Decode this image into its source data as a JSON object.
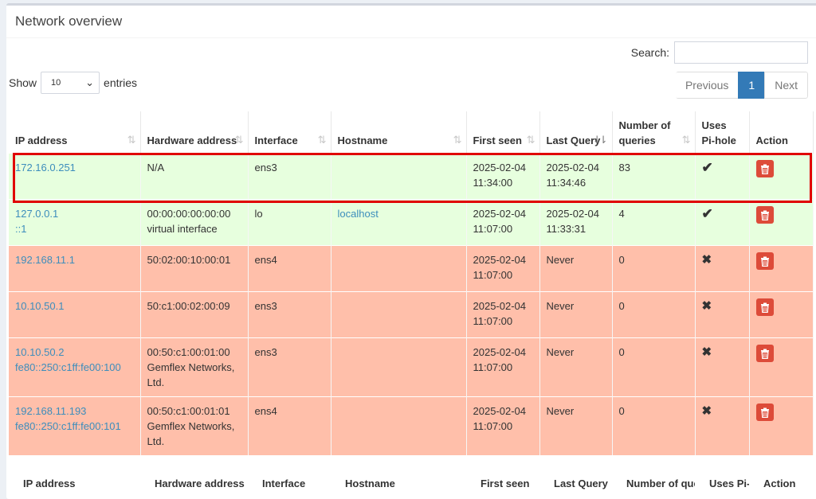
{
  "title": "Network overview",
  "search": {
    "label": "Search:",
    "value": ""
  },
  "length": {
    "show": "Show",
    "value": "10",
    "entries": "entries"
  },
  "pager": {
    "previous": "Previous",
    "current": "1",
    "next": "Next"
  },
  "columns": [
    {
      "label": "IP address",
      "sort": "both"
    },
    {
      "label": "Hardware address",
      "sort": "both"
    },
    {
      "label": "Interface",
      "sort": "both"
    },
    {
      "label": "Hostname",
      "sort": "both"
    },
    {
      "label": "First seen",
      "sort": "both"
    },
    {
      "label": "Last Query",
      "sort": "desc"
    },
    {
      "label": "Number of queries",
      "sort": "both"
    },
    {
      "label": "Uses Pi-hole",
      "sort": "none"
    },
    {
      "label": "Action",
      "sort": "none"
    }
  ],
  "rows": [
    {
      "ip": [
        "172.16.0.251"
      ],
      "hw": [
        "N/A"
      ],
      "iface": "ens3",
      "hostname": "",
      "first_seen": [
        "2025-02-04",
        "11:34:00"
      ],
      "last_query": [
        "2025-02-04",
        "11:34:46"
      ],
      "queries": "83",
      "uses_pihole": true
    },
    {
      "ip": [
        "127.0.0.1",
        "::1"
      ],
      "hw": [
        "00:00:00:00:00:00",
        "virtual interface"
      ],
      "iface": "lo",
      "hostname": "localhost",
      "first_seen": [
        "2025-02-04",
        "11:07:00"
      ],
      "last_query": [
        "2025-02-04",
        "11:33:31"
      ],
      "queries": "4",
      "uses_pihole": true
    },
    {
      "ip": [
        "192.168.11.1"
      ],
      "hw": [
        "50:02:00:10:00:01"
      ],
      "iface": "ens4",
      "hostname": "",
      "first_seen": [
        "2025-02-04",
        "11:07:00"
      ],
      "last_query": [
        "Never"
      ],
      "queries": "0",
      "uses_pihole": false
    },
    {
      "ip": [
        "10.10.50.1"
      ],
      "hw": [
        "50:c1:00:02:00:09"
      ],
      "iface": "ens3",
      "hostname": "",
      "first_seen": [
        "2025-02-04",
        "11:07:00"
      ],
      "last_query": [
        "Never"
      ],
      "queries": "0",
      "uses_pihole": false
    },
    {
      "ip": [
        "10.10.50.2",
        "fe80::250:c1ff:fe00:100"
      ],
      "hw": [
        "00:50:c1:00:01:00",
        "Gemflex Networks,",
        "Ltd."
      ],
      "iface": "ens3",
      "hostname": "",
      "first_seen": [
        "2025-02-04",
        "11:07:00"
      ],
      "last_query": [
        "Never"
      ],
      "queries": "0",
      "uses_pihole": false
    },
    {
      "ip": [
        "192.168.11.193",
        "fe80::250:c1ff:fe00:101"
      ],
      "hw": [
        "00:50:c1:00:01:01",
        "Gemflex Networks,",
        "Ltd."
      ],
      "iface": "ens4",
      "hostname": "",
      "first_seen": [
        "2025-02-04",
        "11:07:00"
      ],
      "last_query": [
        "Never"
      ],
      "queries": "0",
      "uses_pihole": false
    }
  ],
  "footer_columns": [
    "IP address",
    "Hardware address",
    "Interface",
    "Hostname",
    "First seen",
    "Last Query",
    "Number of queries",
    "Uses Pi-hole",
    "Action"
  ],
  "colors": {
    "used": "#e7ffde",
    "unused": "#ffbfaa",
    "link": "#3c8dbc",
    "delete": "#dd4b39",
    "highlight": "#e00000"
  },
  "icons": {
    "sort": "sort-icon",
    "check": "check-icon",
    "cross": "cross-icon",
    "delete": "trash-icon",
    "select": "chevron-down-icon"
  }
}
